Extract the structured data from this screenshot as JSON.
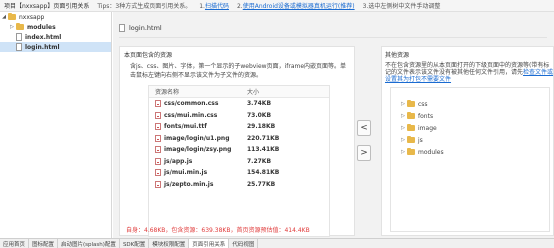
{
  "topbar": {
    "title": "项目【nxxsapp】页面引用关系",
    "tips": "Tips：3种方式生成页面引用关系。",
    "step1": "1.",
    "step1_link": "扫描代码",
    "step2": "2.",
    "step2_link": "使用Android设备或模拟器真机运行(推荐)",
    "step3": "3.选中左侧树中文件手动调整"
  },
  "tree": {
    "root": "nxxsapp",
    "items": [
      {
        "label": "modules",
        "type": "folder"
      },
      {
        "label": "index.html",
        "type": "file"
      },
      {
        "label": "login.html",
        "type": "file",
        "selected": true
      }
    ]
  },
  "main": {
    "current_file": "login.html",
    "left_panel": {
      "title": "本页面包含的资源",
      "description": "含js、css、图片、字体，第一个显示的子webview页面，iframe内嵌页面等。单击鼠标左键向右侧不显示该文件为子文件的资源。",
      "table_headers": [
        "资源名称",
        "大小"
      ],
      "resources": [
        {
          "name": "css/common.css",
          "size": "3.74KB"
        },
        {
          "name": "css/mui.min.css",
          "size": "73.0KB"
        },
        {
          "name": "fonts/mui.ttf",
          "size": "29.18KB"
        },
        {
          "name": "image/login/u1.png",
          "size": "220.71KB"
        },
        {
          "name": "image/login/zsy.png",
          "size": "113.41KB"
        },
        {
          "name": "js/app.js",
          "size": "7.27KB"
        },
        {
          "name": "js/mui.min.js",
          "size": "154.81KB"
        },
        {
          "name": "js/zepto.min.js",
          "size": "25.77KB"
        }
      ],
      "summary": "自身：4.68KB，包含资源：639.38KB，首页资源预估值：414.4KB"
    },
    "right_panel": {
      "title": "其他资源",
      "description": "不在包含资源里的从本页面打开的下级页面中的资源等(带有标记的文件表示该文件没有被其他任何文件引用，请先",
      "description_link": "检查文件或设置其为打包不需要文件",
      "folders": [
        "css",
        "fonts",
        "image",
        "js",
        "modules"
      ]
    },
    "buttons": {
      "move_left": "<",
      "move_right": ">"
    }
  },
  "bottom_tabs": [
    "应用首页",
    "图标配置",
    "启动图片(splash)配置",
    "SDK配置",
    "模块权限配置",
    "页面引用关系",
    "代码视图"
  ]
}
